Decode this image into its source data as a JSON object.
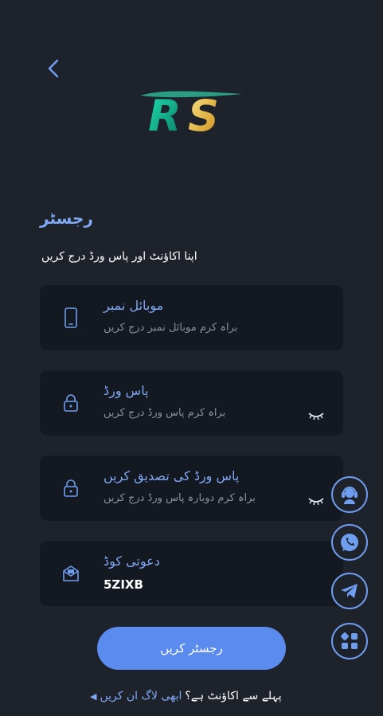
{
  "header": {
    "back_icon": "chevron-left-icon",
    "logo_text": "RS"
  },
  "form": {
    "title": "رجسٹر",
    "subtitle": "اپنا اکاؤنٹ اور پاس ورڈ درج کریں",
    "fields": [
      {
        "label": "موبائل نمبر",
        "placeholder": "براہ کرم موبائل نمبر درج کریں",
        "icon": "phone-icon"
      },
      {
        "label": "پاس ورڈ",
        "placeholder": "براہ کرم پاس ورڈ درج کریں",
        "icon": "lock-icon"
      },
      {
        "label": "پاس ورڈ کی تصدیق کریں",
        "placeholder": "براہ کرم دوبارہ پاس ورڈ درج کریں",
        "icon": "lock-icon"
      },
      {
        "label": "دعوتی کوڈ",
        "value": "5ZIXB",
        "icon": "invite-icon"
      }
    ],
    "submit_label": "رجسٹر کریں"
  },
  "footer": {
    "link_text": "ابھی لاگ ان کریں",
    "question": "پہلے سے اکاؤنٹ ہے؟"
  },
  "floating": [
    "support-agent-icon",
    "whatsapp-icon",
    "telegram-icon",
    "apps-icon"
  ],
  "colors": {
    "accent": "#7fa8f5",
    "button": "#5c8bef",
    "background": "#1e222b",
    "field_bg": "#141820"
  }
}
